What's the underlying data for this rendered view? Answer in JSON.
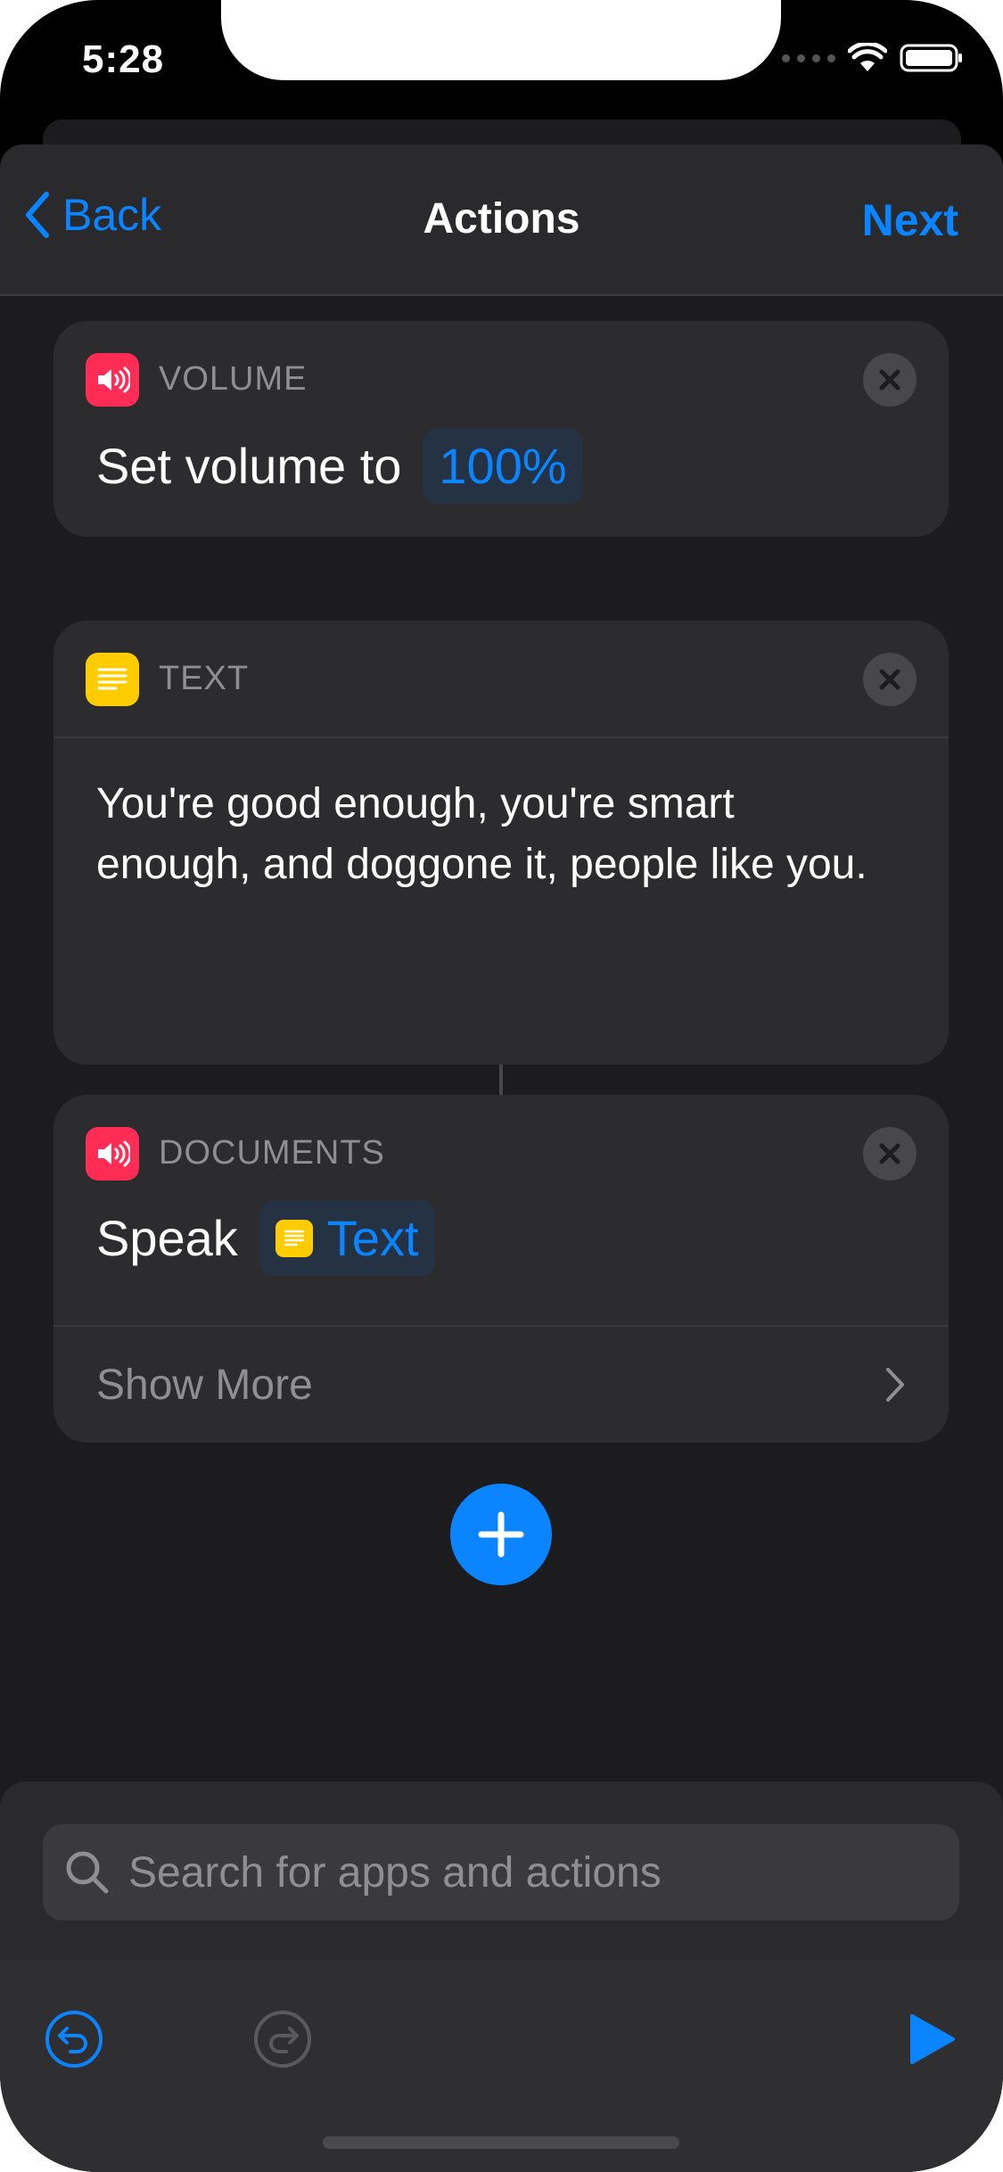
{
  "status_bar": {
    "time": "5:28"
  },
  "nav": {
    "back_label": "Back",
    "title": "Actions",
    "next_label": "Next"
  },
  "actions": [
    {
      "category": "VOLUME",
      "icon": "speaker-icon",
      "icon_color": "#ff2d55",
      "prefix": "Set volume to",
      "token": "100%"
    },
    {
      "category": "TEXT",
      "icon": "text-lines-icon",
      "icon_color": "#ffcc00",
      "content": "You're good enough, you're smart enough, and doggone it, people like you."
    },
    {
      "category": "DOCUMENTS",
      "icon": "speaker-icon",
      "icon_color": "#ff2d55",
      "prefix": "Speak",
      "token": "Text",
      "show_more_label": "Show More"
    }
  ],
  "search": {
    "placeholder": "Search for apps and actions"
  },
  "colors": {
    "accent": "#0a84ff",
    "background": "#1c1c1e",
    "card": "#2c2c2e"
  }
}
